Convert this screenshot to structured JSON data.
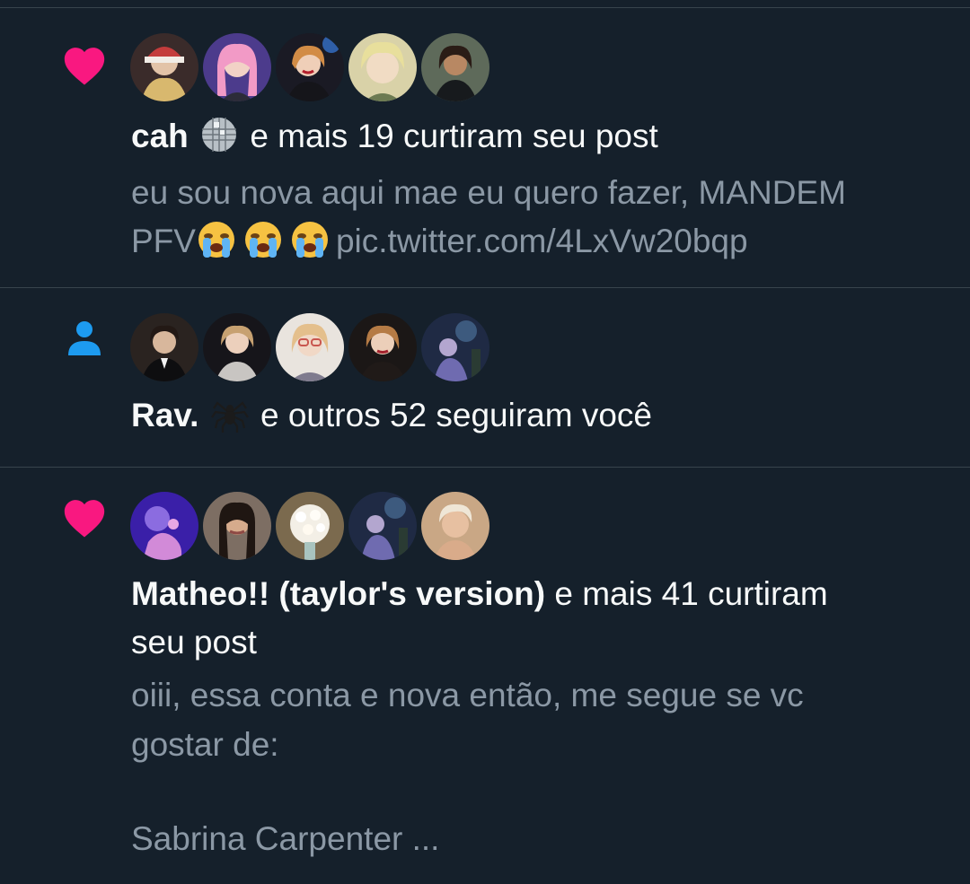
{
  "colors": {
    "background": "#15202b",
    "divider": "#38444d",
    "text_primary": "#f7f9f9",
    "text_secondary": "#8b98a5",
    "like": "#f91880",
    "follow": "#1d9bf0"
  },
  "notifications": [
    {
      "type": "like",
      "icon": "heart-icon",
      "user_name": "cah",
      "user_emoji": "disco-ball-emoji",
      "action": "e mais 19 curtiram seu post",
      "snippet_line1": "eu sou nova aqui mae eu quero fazer, MANDEM",
      "snippet_line2_text": "PFV",
      "snippet_line2_emojis": [
        "loudly-crying-face-emoji",
        "loudly-crying-face-emoji",
        "loudly-crying-face-emoji"
      ],
      "snippet_line2_link": "pic.twitter.com/4LxVw20bqp",
      "avatars": [
        "avatar-1",
        "avatar-2",
        "avatar-3",
        "avatar-4",
        "avatar-5"
      ]
    },
    {
      "type": "follow",
      "icon": "person-icon",
      "user_name": "Rav.",
      "user_emoji": "spider-emoji",
      "action": "e outros 52 seguiram você",
      "avatars": [
        "avatar-1",
        "avatar-2",
        "avatar-3",
        "avatar-4",
        "avatar-5"
      ]
    },
    {
      "type": "like",
      "icon": "heart-icon",
      "user_name": "Matheo!! (taylor's version)",
      "action_line1": "e mais 41 curtiram",
      "action_line2": "seu post",
      "snippet_line1": "oiii, essa conta e nova então, me segue se vc",
      "snippet_line2": "gostar de:",
      "snippet_line3": "Sabrina Carpenter ...",
      "avatars": [
        "avatar-1",
        "avatar-2",
        "avatar-3",
        "avatar-4",
        "avatar-5"
      ]
    }
  ]
}
